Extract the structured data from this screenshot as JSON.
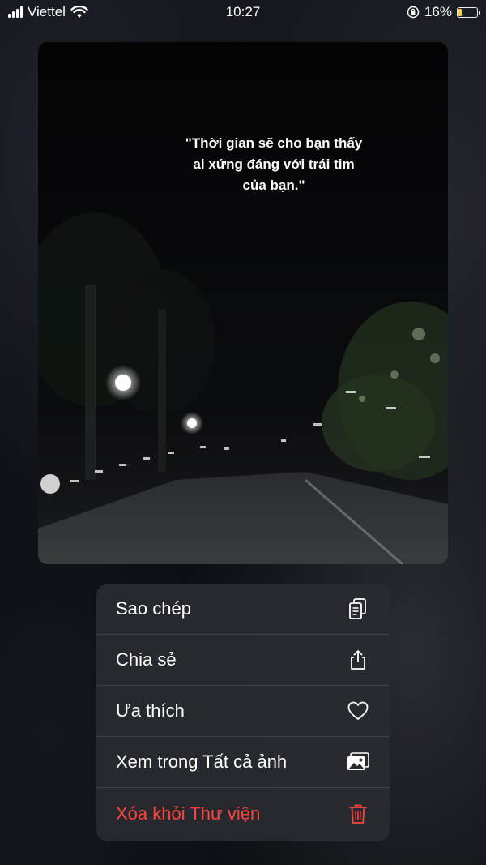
{
  "status_bar": {
    "carrier": "Viettel",
    "time": "10:27",
    "battery_percent": "16%",
    "battery_level": 0.16,
    "battery_color": "#f3d23a"
  },
  "photo": {
    "caption": "\"Thời gian sẽ cho bạn thấy ai xứng đáng với trái tim của bạn.\""
  },
  "context_menu": {
    "items": [
      {
        "label": "Sao chép",
        "icon": "copy-icon"
      },
      {
        "label": "Chia sẻ",
        "icon": "share-icon"
      },
      {
        "label": "Ưa thích",
        "icon": "heart-icon"
      },
      {
        "label": "Xem trong Tất cả ảnh",
        "icon": "photos-icon"
      },
      {
        "label": "Xóa khỏi Thư viện",
        "icon": "trash-icon",
        "destructive": true,
        "color": "#ff453a"
      }
    ]
  }
}
